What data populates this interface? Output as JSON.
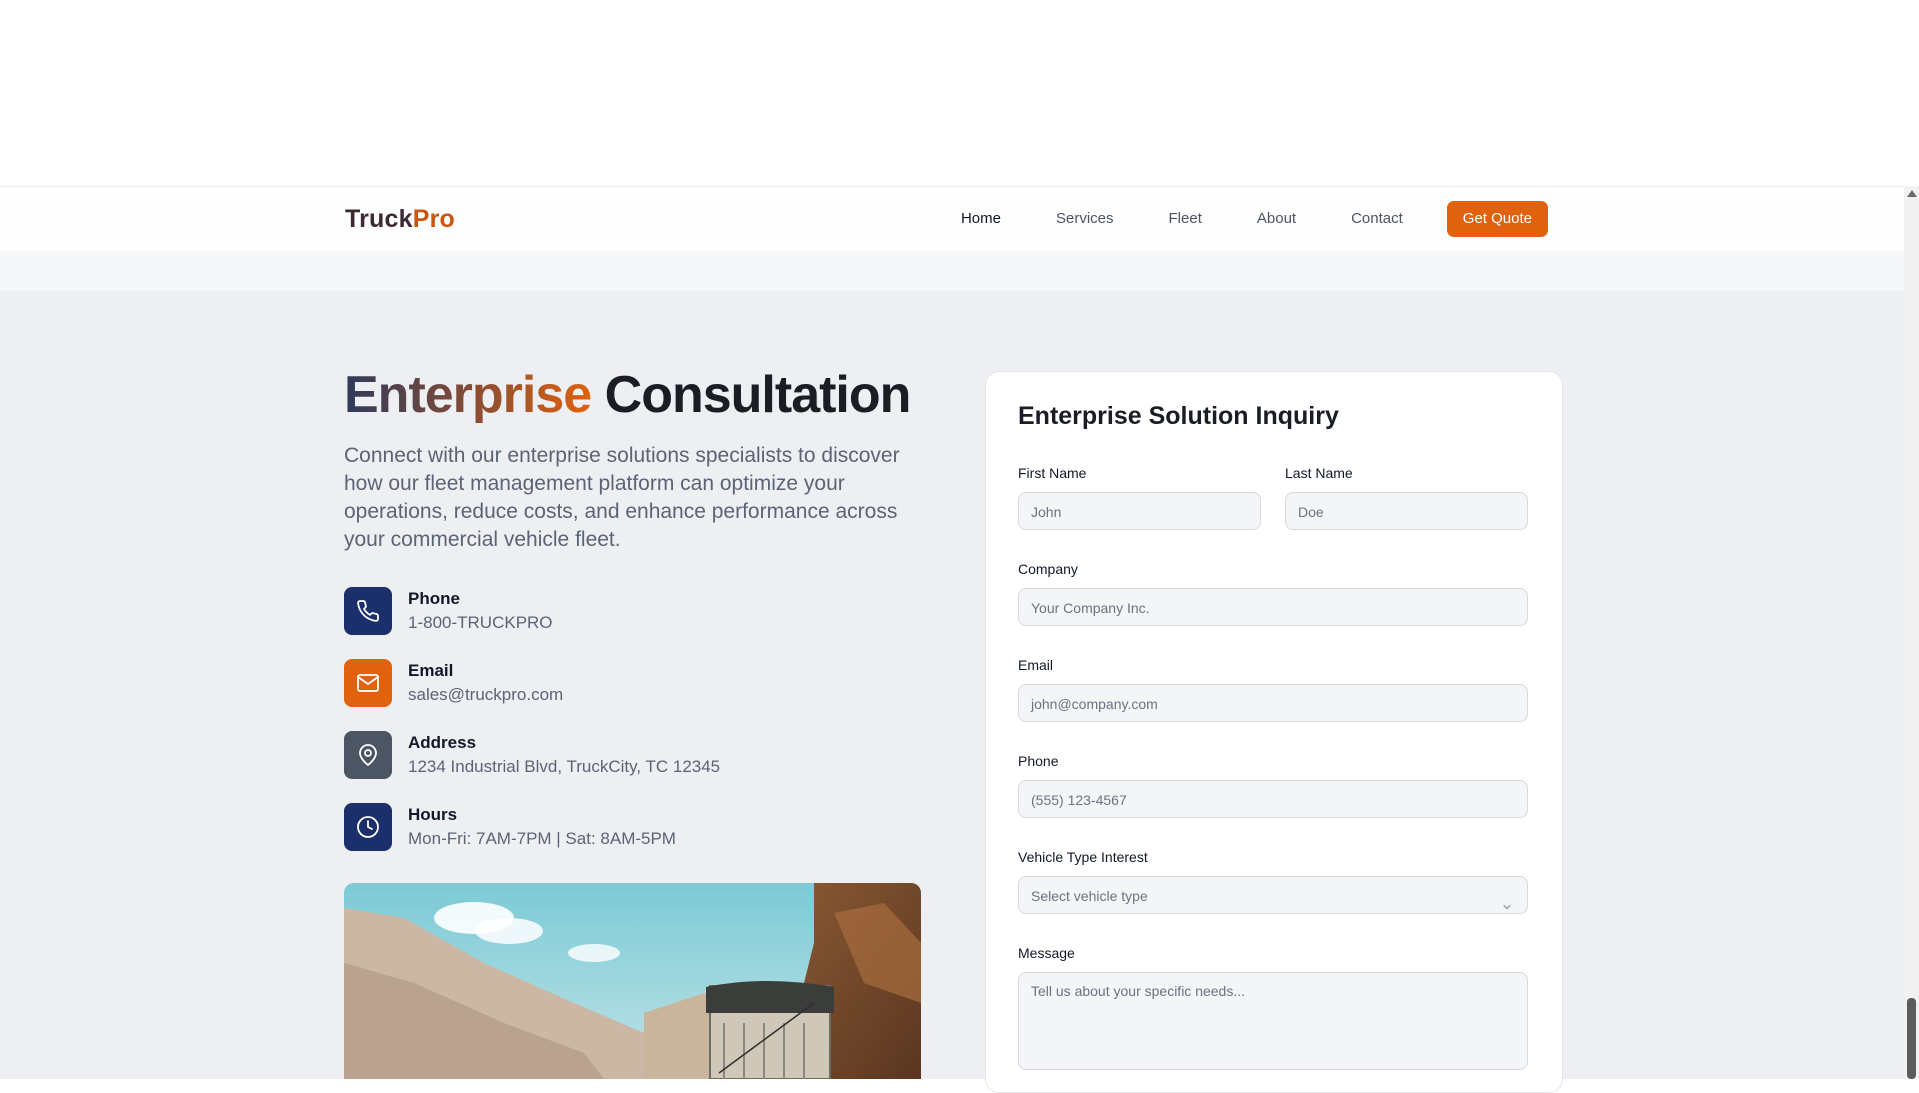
{
  "nav": {
    "logo_part1": "Truck",
    "logo_part2": "Pro",
    "links": [
      "Home",
      "Services",
      "Fleet",
      "About",
      "Contact"
    ],
    "cta": "Get Quote"
  },
  "hero": {
    "title_highlight": "Enterprise",
    "title_rest": "Consultation",
    "description": "Connect with our enterprise solutions specialists to discover how our fleet management platform can optimize your operations, reduce costs, and enhance performance across your commercial vehicle fleet."
  },
  "contact": [
    {
      "label": "Phone",
      "value": "1-800-TRUCKPRO",
      "icon": "phone-icon",
      "color": "#1b2f6b"
    },
    {
      "label": "Email",
      "value": "sales@truckpro.com",
      "icon": "mail-icon",
      "color": "#e0620e"
    },
    {
      "label": "Address",
      "value": "1234 Industrial Blvd, TruckCity, TC 12345",
      "icon": "map-pin-icon",
      "color": "#4b5563"
    },
    {
      "label": "Hours",
      "value": "Mon-Fri: 7AM-7PM | Sat: 8AM-5PM",
      "icon": "clock-icon",
      "color": "#1b2f6b"
    }
  ],
  "form": {
    "title": "Enterprise Solution Inquiry",
    "first_name": {
      "label": "First Name",
      "placeholder": "John"
    },
    "last_name": {
      "label": "Last Name",
      "placeholder": "Doe"
    },
    "company": {
      "label": "Company",
      "placeholder": "Your Company Inc."
    },
    "email": {
      "label": "Email",
      "placeholder": "john@company.com"
    },
    "phone": {
      "label": "Phone",
      "placeholder": "(555) 123-4567"
    },
    "vehicle": {
      "label": "Vehicle Type Interest",
      "selected": "Select vehicle type"
    },
    "message": {
      "label": "Message",
      "placeholder": "Tell us about your specific needs..."
    }
  },
  "colors": {
    "accent": "#e0620e",
    "navy": "#1b2f6b",
    "text": "#111827",
    "muted": "#5b6474"
  }
}
